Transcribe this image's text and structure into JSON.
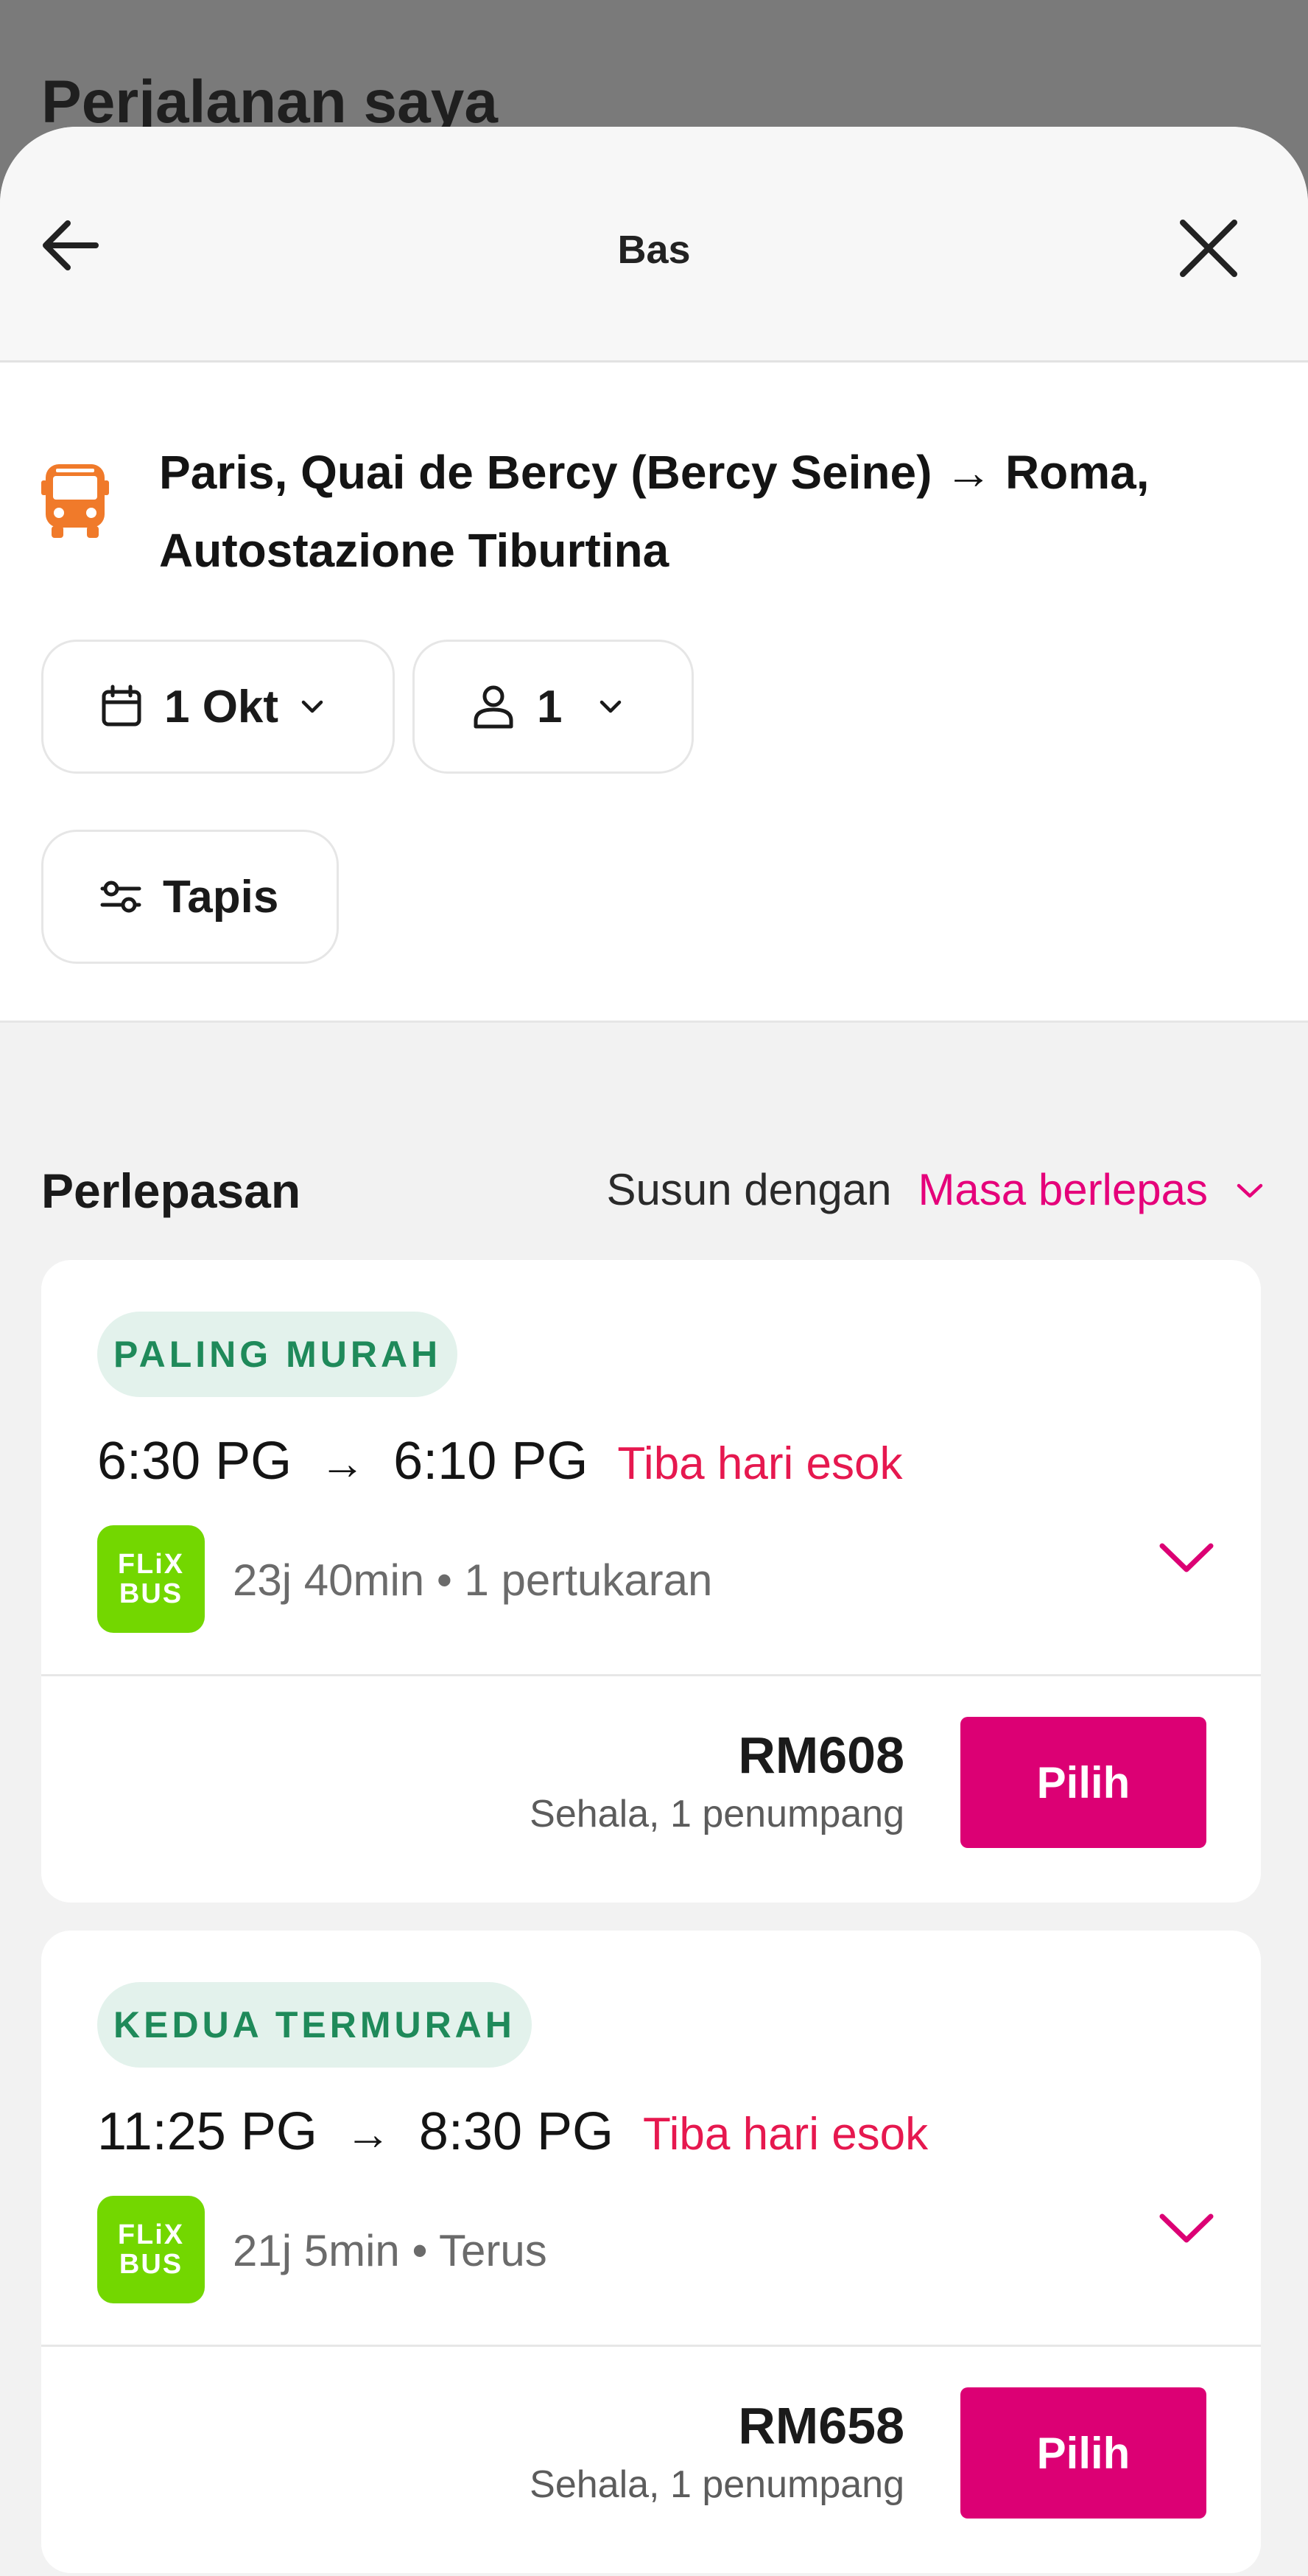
{
  "background": {
    "title": "Perjalanan saya"
  },
  "sheet": {
    "title": "Bas",
    "route": "Paris, Quai de Bercy (Bercy Seine) → Roma, Autostazione Tiburtina",
    "date_chip": "1 Okt",
    "passenger_chip": "1",
    "filter_chip": "Tapis"
  },
  "results": {
    "heading": "Perlepasan",
    "sort_label": "Susun dengan",
    "sort_value": "Masa berlepas",
    "items": [
      {
        "badge": "PALING MURAH",
        "depart": "6:30 PG",
        "arrow": "→",
        "arrive": "6:10 PG",
        "next_day": "Tiba hari esok",
        "logo_line1": "FLiX",
        "logo_line2": "BUS",
        "meta": "23j 40min • 1 pertukaran",
        "price": "RM608",
        "price_sub": "Sehala, 1 penumpang",
        "button": "Pilih"
      },
      {
        "badge": "KEDUA TERMURAH",
        "depart": "11:25 PG",
        "arrow": "→",
        "arrive": "8:30 PG",
        "next_day": "Tiba hari esok",
        "logo_line1": "FLiX",
        "logo_line2": "BUS",
        "meta": "21j 5min • Terus",
        "price": "RM658",
        "price_sub": "Sehala, 1 penumpang",
        "button": "Pilih"
      }
    ]
  },
  "colors": {
    "accent": "#dc0074",
    "sort_accent": "#e5007a",
    "next_day": "#e6184f",
    "badge_text": "#1f8a5a",
    "badge_bg": "#e3f2ec",
    "flixbus": "#73d700",
    "bus_icon": "#f07a2a"
  },
  "icons": {
    "back": "arrow-left-icon",
    "close": "close-icon",
    "route": "bus-icon",
    "date": "calendar-icon",
    "passengers": "person-icon",
    "filter": "sliders-icon",
    "dropdown": "chevron-down-icon"
  }
}
